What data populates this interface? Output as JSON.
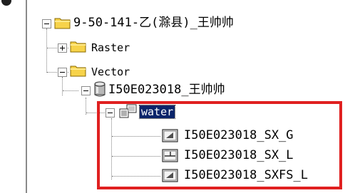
{
  "tree": {
    "root": {
      "label": "9-50-141-乙(滁县)_王帅帅",
      "icon": "folder-icon",
      "state": "expanded"
    },
    "raster": {
      "label": "Raster",
      "icon": "folder-icon",
      "state": "collapsed"
    },
    "vector": {
      "label": "Vector",
      "icon": "folder-icon",
      "state": "expanded"
    },
    "database": {
      "label": "I50E023018_王帅帅",
      "icon": "geodatabase-icon",
      "state": "expanded"
    },
    "dataset": {
      "label": "water",
      "icon": "feature-dataset-icon",
      "state": "expanded",
      "selected": true
    },
    "layers": [
      {
        "label": "I50E023018_SX_G",
        "icon": "polygon-feature-class-icon"
      },
      {
        "label": "I50E023018_SX_L",
        "icon": "line-feature-class-icon"
      },
      {
        "label": "I50E023018_SXFS_L",
        "icon": "polygon-feature-class-icon"
      }
    ]
  },
  "colors": {
    "highlight_border": "#e02020",
    "selection_background": "#0a246a",
    "selection_text": "#ffffff",
    "folder_yellow": "#f7d34a"
  }
}
